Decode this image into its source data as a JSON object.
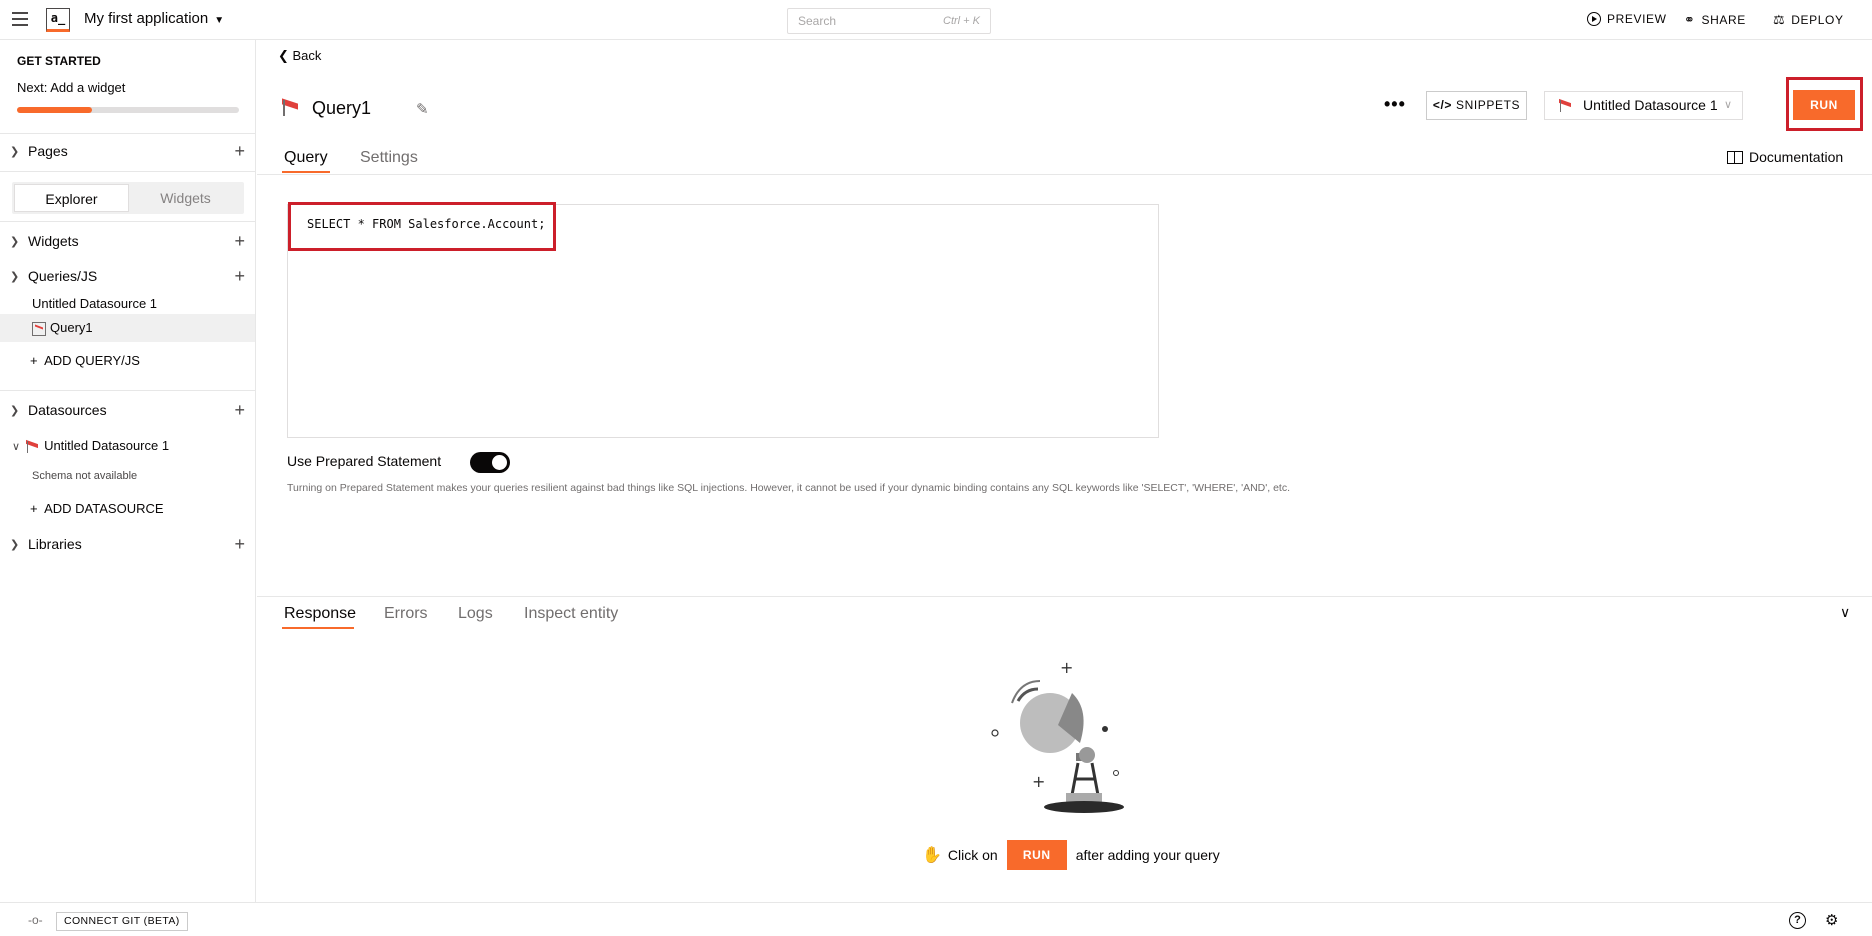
{
  "header": {
    "logo_text": "a_",
    "app_name": "My first application",
    "search_placeholder": "Search",
    "search_shortcut": "Ctrl + K",
    "preview_label": "PREVIEW",
    "share_label": "SHARE",
    "deploy_label": "DEPLOY"
  },
  "sidebar": {
    "get_started_title": "GET STARTED",
    "next_step": "Next: Add a widget",
    "progress_fraction": 0.34,
    "pages_label": "Pages",
    "toggle": {
      "explorer": "Explorer",
      "widgets": "Widgets"
    },
    "widgets_label": "Widgets",
    "queries_label": "Queries/JS",
    "queries_group": "Untitled Datasource 1",
    "query_item": "Query1",
    "add_query_label": "ADD QUERY/JS",
    "datasources_label": "Datasources",
    "datasource_item": "Untitled Datasource 1",
    "schema_status": "Schema not available",
    "add_datasource_label": "ADD DATASOURCE",
    "libraries_label": "Libraries"
  },
  "editor": {
    "back_label": "Back",
    "query_name": "Query1",
    "more_label": "•••",
    "snippets_label": "SNIPPETS",
    "datasource_selected": "Untitled Datasource 1",
    "run_label": "RUN",
    "tabs": [
      "Query",
      "Settings"
    ],
    "documentation_label": "Documentation",
    "query_text": "SELECT * FROM Salesforce.Account;",
    "prepared_statement_label": "Use Prepared Statement",
    "prepared_statement_on": true,
    "prepared_statement_help": "Turning on Prepared Statement makes your queries resilient against bad things like SQL injections. However, it cannot be used if your dynamic binding contains any SQL keywords like 'SELECT', 'WHERE', 'AND', etc."
  },
  "response": {
    "tabs": [
      "Response",
      "Errors",
      "Logs",
      "Inspect entity"
    ],
    "empty_prefix": "Click on",
    "empty_run_label": "RUN",
    "empty_suffix": "after adding your query"
  },
  "footer": {
    "connect_git_label": "CONNECT GIT (BETA)",
    "help_label": "?"
  },
  "colors": {
    "accent": "#f86a2b",
    "highlight_outline": "#cc1f2a"
  },
  "icons": [
    "menu-icon",
    "chevron-down-icon",
    "play-icon",
    "share-icon",
    "deploy-icon",
    "pencil-icon",
    "code-icon",
    "salesforce-icon",
    "book-icon",
    "plus-icon",
    "caret-right-icon",
    "caret-down-icon",
    "git-icon",
    "help-icon",
    "bug-icon",
    "hand-icon"
  ]
}
